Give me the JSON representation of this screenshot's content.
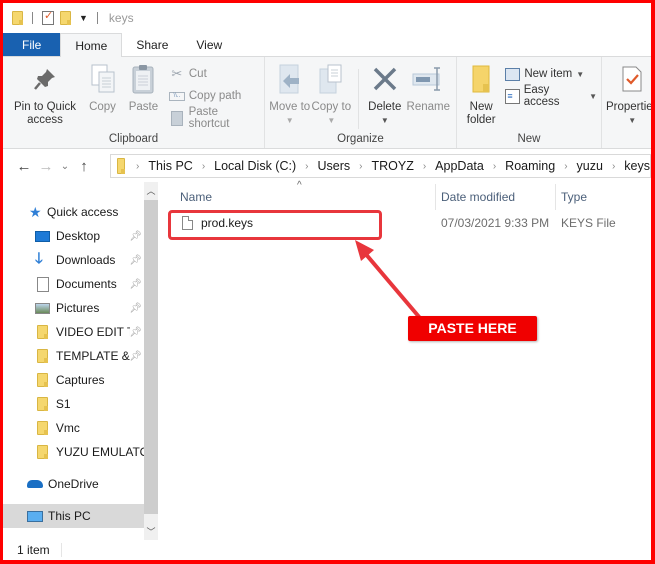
{
  "window": {
    "title": "keys"
  },
  "quick_access_toolbar": {
    "icons": [
      "folder-icon",
      "properties-icon",
      "new-folder-icon",
      "customize-dropdown-icon"
    ]
  },
  "tabs": [
    {
      "label": "File",
      "type": "file"
    },
    {
      "label": "Home",
      "active": true
    },
    {
      "label": "Share"
    },
    {
      "label": "View"
    }
  ],
  "ribbon": {
    "clipboard": {
      "label": "Clipboard",
      "pin": "Pin to Quick access",
      "copy": "Copy",
      "paste": "Paste",
      "cut": "Cut",
      "copy_path": "Copy path",
      "paste_shortcut": "Paste shortcut"
    },
    "organize": {
      "label": "Organize",
      "move_to": "Move to",
      "copy_to": "Copy to",
      "delete": "Delete",
      "rename": "Rename"
    },
    "new": {
      "label": "New",
      "new_folder": "New folder",
      "new_item": "New item",
      "easy_access": "Easy access"
    },
    "open": {
      "properties": "Properties"
    }
  },
  "address_bar": {
    "breadcrumbs": [
      "This PC",
      "Local Disk (C:)",
      "Users",
      "TROYZ",
      "AppData",
      "Roaming",
      "yuzu",
      "keys"
    ]
  },
  "nav_pane": {
    "items": [
      {
        "label": "Quick access",
        "icon": "quick-access-star-icon",
        "pinned": false,
        "level": 0
      },
      {
        "label": "Desktop",
        "icon": "desktop-icon",
        "pinned": true,
        "level": 1
      },
      {
        "label": "Downloads",
        "icon": "downloads-icon",
        "pinned": true,
        "level": 1
      },
      {
        "label": "Documents",
        "icon": "documents-icon",
        "pinned": true,
        "level": 1
      },
      {
        "label": "Pictures",
        "icon": "pictures-icon",
        "pinned": true,
        "level": 1
      },
      {
        "label": "VIDEO EDIT T",
        "icon": "folder-icon",
        "pinned": true,
        "level": 1
      },
      {
        "label": "TEMPLATE &",
        "icon": "folder-icon",
        "pinned": true,
        "level": 1
      },
      {
        "label": "Captures",
        "icon": "folder-icon",
        "pinned": false,
        "level": 1
      },
      {
        "label": "S1",
        "icon": "folder-icon",
        "pinned": false,
        "level": 1
      },
      {
        "label": "Vmc",
        "icon": "folder-icon",
        "pinned": false,
        "level": 1
      },
      {
        "label": "YUZU EMULATO",
        "icon": "folder-icon",
        "pinned": false,
        "level": 1
      },
      {
        "label": "OneDrive",
        "icon": "onedrive-icon",
        "pinned": false,
        "level": 0
      },
      {
        "label": "This PC",
        "icon": "this-pc-icon",
        "pinned": false,
        "level": 0,
        "selected": true
      }
    ]
  },
  "file_list": {
    "columns": [
      "Name",
      "Date modified",
      "Type"
    ],
    "rows": [
      {
        "name": "prod.keys",
        "date_modified": "07/03/2021 9:33 PM",
        "type": "KEYS File"
      }
    ]
  },
  "annotation": {
    "label": "PASTE HERE",
    "color": "#f00000"
  },
  "status_bar": {
    "item_count": "1 item"
  },
  "colors": {
    "file_tab": "#1961b0",
    "frame_border": "#ff0000",
    "highlight_box": "#e8363c"
  }
}
